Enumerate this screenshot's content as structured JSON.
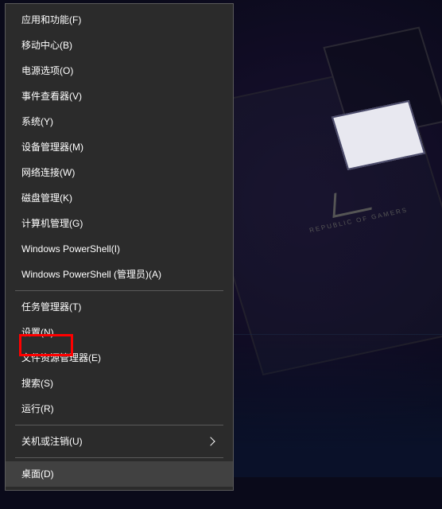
{
  "menu": {
    "section1": [
      {
        "label": "应用和功能(F)"
      },
      {
        "label": "移动中心(B)"
      },
      {
        "label": "电源选项(O)"
      },
      {
        "label": "事件查看器(V)"
      },
      {
        "label": "系统(Y)"
      },
      {
        "label": "设备管理器(M)"
      },
      {
        "label": "网络连接(W)"
      },
      {
        "label": "磁盘管理(K)"
      },
      {
        "label": "计算机管理(G)"
      },
      {
        "label": "Windows PowerShell(I)"
      },
      {
        "label": "Windows PowerShell (管理员)(A)"
      }
    ],
    "section2": [
      {
        "label": "任务管理器(T)"
      },
      {
        "label": "设置(N)"
      },
      {
        "label": "文件资源管理器(E)"
      },
      {
        "label": "搜索(S)"
      },
      {
        "label": "运行(R)"
      }
    ],
    "section3": [
      {
        "label": "关机或注销(U)",
        "submenu": true
      }
    ],
    "section4": [
      {
        "label": "桌面(D)",
        "hovered": true
      }
    ]
  },
  "bg": {
    "brandText": "REPUBLIC OF GAMERS"
  }
}
